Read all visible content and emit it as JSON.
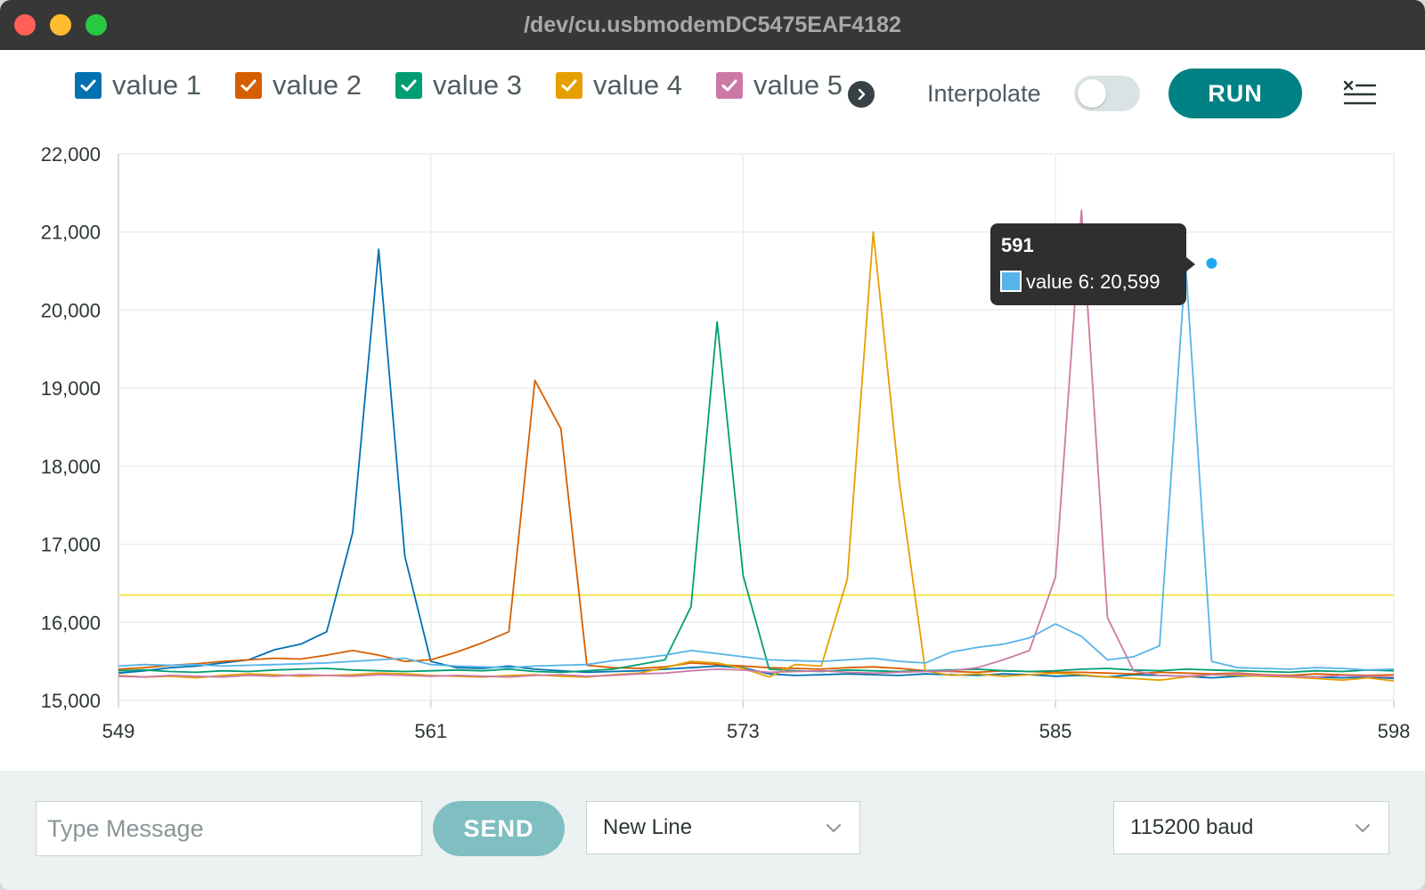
{
  "window": {
    "title": "/dev/cu.usbmodemDC5475EAF4182"
  },
  "toolbar": {
    "legend": [
      {
        "label": "value 1",
        "color": "#0072b2",
        "checked": true
      },
      {
        "label": "value 2",
        "color": "#d55e00",
        "checked": true
      },
      {
        "label": "value 3",
        "color": "#009e73",
        "checked": true
      },
      {
        "label": "value 4",
        "color": "#e69f00",
        "checked": true
      },
      {
        "label": "value 5",
        "color": "#cc79a7",
        "checked": true
      }
    ],
    "interpolate_label": "Interpolate",
    "interpolate_on": false,
    "run_label": "RUN"
  },
  "tooltip": {
    "x_label": "591",
    "series_text": "value 6: 20,599",
    "swatch_color": "#56b4e9"
  },
  "chart_data": {
    "type": "line",
    "xlim": [
      549,
      598
    ],
    "ylim": [
      15000,
      22000
    ],
    "x_ticks": [
      549,
      561,
      573,
      585,
      598
    ],
    "x_tick_labels": [
      "549",
      "561",
      "573",
      "585",
      "598"
    ],
    "y_ticks": [
      15000,
      16000,
      17000,
      18000,
      19000,
      20000,
      21000,
      22000
    ],
    "y_tick_labels": [
      "15,000",
      "16,000",
      "17,000",
      "18,000",
      "19,000",
      "20,000",
      "21,000",
      "22,000"
    ],
    "grid": true,
    "reference_line": {
      "y": 16350,
      "color": "#f0e442"
    },
    "x": [
      549,
      550,
      551,
      552,
      553,
      554,
      555,
      556,
      557,
      558,
      559,
      560,
      561,
      562,
      563,
      564,
      565,
      566,
      567,
      568,
      569,
      570,
      571,
      572,
      573,
      574,
      575,
      576,
      577,
      578,
      579,
      580,
      581,
      582,
      583,
      584,
      585,
      586,
      587,
      588,
      589,
      590,
      591,
      592,
      593,
      594,
      595,
      596,
      597,
      598
    ],
    "series": [
      {
        "name": "value 1",
        "color": "#0072b2",
        "values": [
          15350,
          15380,
          15420,
          15440,
          15480,
          15520,
          15650,
          15720,
          15880,
          17150,
          20780,
          16850,
          15500,
          15420,
          15410,
          15440,
          15400,
          15380,
          15360,
          15370,
          15380,
          15400,
          15420,
          15440,
          15420,
          15340,
          15320,
          15330,
          15340,
          15330,
          15320,
          15340,
          15330,
          15320,
          15340,
          15330,
          15310,
          15320,
          15300,
          15330,
          15320,
          15310,
          15290,
          15310,
          15320,
          15310,
          15300,
          15290,
          15300,
          15280
        ]
      },
      {
        "name": "value 2",
        "color": "#d55e00",
        "values": [
          15400,
          15420,
          15450,
          15470,
          15500,
          15520,
          15540,
          15530,
          15580,
          15640,
          15580,
          15500,
          15520,
          15620,
          15740,
          15880,
          19100,
          18480,
          15450,
          15420,
          15410,
          15430,
          15480,
          15460,
          15440,
          15420,
          15410,
          15400,
          15420,
          15430,
          15410,
          15380,
          15370,
          15360,
          15380,
          15370,
          15360,
          15360,
          15350,
          15340,
          15360,
          15350,
          15340,
          15350,
          15330,
          15320,
          15340,
          15330,
          15320,
          15330
        ]
      },
      {
        "name": "value 3",
        "color": "#009e73",
        "values": [
          15380,
          15390,
          15370,
          15360,
          15380,
          15370,
          15390,
          15400,
          15410,
          15390,
          15380,
          15370,
          15380,
          15390,
          15380,
          15400,
          15370,
          15360,
          15380,
          15400,
          15460,
          15520,
          16200,
          19850,
          16600,
          15400,
          15380,
          15370,
          15390,
          15380,
          15370,
          15380,
          15390,
          15400,
          15380,
          15370,
          15380,
          15400,
          15410,
          15390,
          15380,
          15400,
          15390,
          15380,
          15370,
          15360,
          15380,
          15370,
          15390,
          15380
        ]
      },
      {
        "name": "value 4",
        "color": "#e69f00",
        "values": [
          15320,
          15300,
          15310,
          15290,
          15320,
          15340,
          15330,
          15310,
          15320,
          15330,
          15350,
          15340,
          15320,
          15310,
          15300,
          15320,
          15330,
          15310,
          15300,
          15330,
          15350,
          15420,
          15500,
          15480,
          15410,
          15300,
          15460,
          15440,
          16550,
          21000,
          17800,
          15380,
          15320,
          15340,
          15310,
          15330,
          15350,
          15330,
          15300,
          15280,
          15260,
          15300,
          15330,
          15320,
          15310,
          15300,
          15280,
          15260,
          15290,
          15250
        ]
      },
      {
        "name": "value 5",
        "color": "#cc79a7",
        "values": [
          15310,
          15300,
          15320,
          15310,
          15300,
          15320,
          15310,
          15330,
          15320,
          15310,
          15330,
          15320,
          15310,
          15320,
          15310,
          15300,
          15320,
          15330,
          15310,
          15320,
          15340,
          15350,
          15380,
          15400,
          15390,
          15360,
          15370,
          15380,
          15360,
          15350,
          15360,
          15370,
          15380,
          15420,
          15520,
          15640,
          16580,
          21280,
          16060,
          15380,
          15320,
          15310,
          15330,
          15340,
          15320,
          15310,
          15300,
          15320,
          15310,
          15300
        ]
      },
      {
        "name": "value 6",
        "color": "#56b4e9",
        "values": [
          15440,
          15460,
          15450,
          15460,
          15440,
          15450,
          15460,
          15470,
          15480,
          15500,
          15520,
          15540,
          15460,
          15440,
          15430,
          15420,
          15440,
          15450,
          15460,
          15510,
          15540,
          15580,
          15640,
          15600,
          15560,
          15520,
          15510,
          15500,
          15520,
          15540,
          15500,
          15480,
          15620,
          15680,
          15720,
          15800,
          15980,
          15820,
          15520,
          15560,
          15700,
          20599,
          15500,
          15420,
          15410,
          15400,
          15420,
          15410,
          15390,
          15400
        ]
      }
    ],
    "highlight": {
      "series": "value 6",
      "x": 591,
      "y": 20599
    }
  },
  "bottom": {
    "message_placeholder": "Type Message",
    "send_label": "SEND",
    "line_ending": "New Line",
    "baud": "115200 baud"
  }
}
